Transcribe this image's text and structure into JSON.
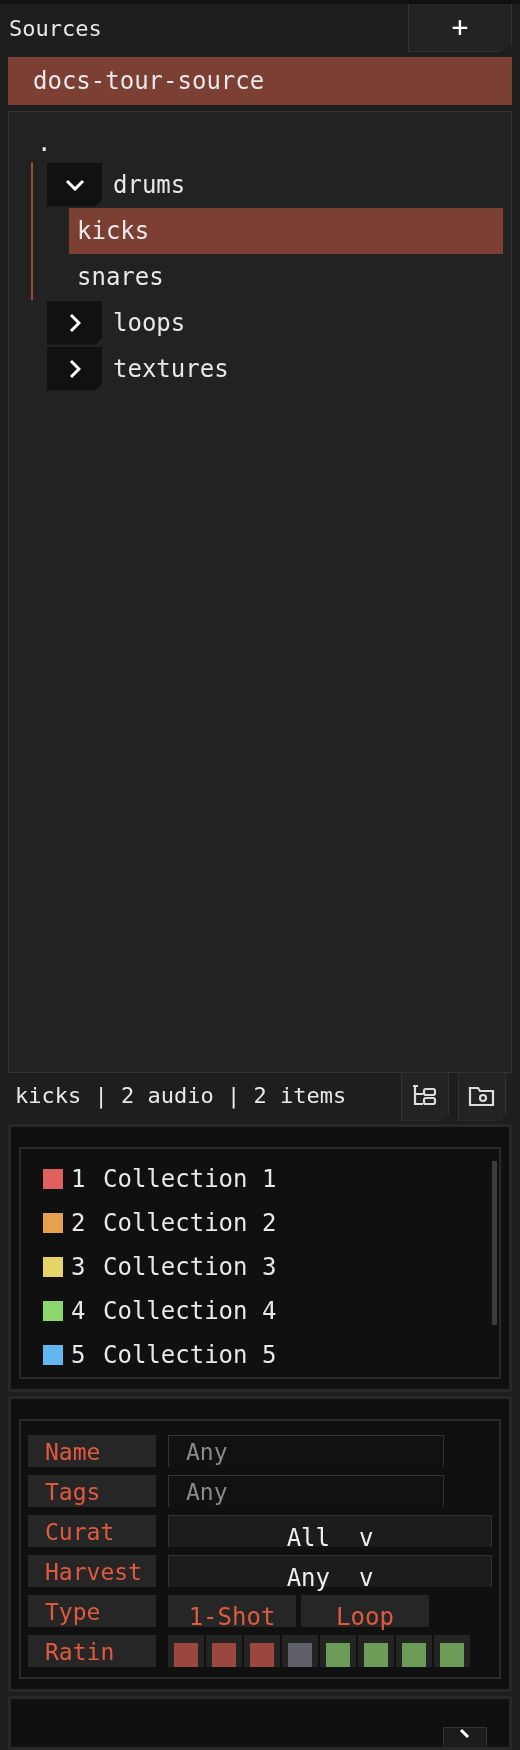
{
  "sources": {
    "title": "Sources",
    "add_button": "+",
    "items": [
      {
        "label": "docs-tour-source",
        "selected": true
      }
    ]
  },
  "tree": {
    "label": ".",
    "children": [
      {
        "label": "drums",
        "expanded": true,
        "selected": false,
        "children": [
          {
            "label": "kicks",
            "selected": true
          },
          {
            "label": "snares",
            "selected": false
          }
        ]
      },
      {
        "label": "loops",
        "expanded": false,
        "selected": false
      },
      {
        "label": "textures",
        "expanded": false,
        "selected": false
      }
    ]
  },
  "status": {
    "text": "kicks | 2 audio | 2 items"
  },
  "collections": [
    {
      "number": "1",
      "name": "Collection 1",
      "color": "#e06060"
    },
    {
      "number": "2",
      "name": "Collection 2",
      "color": "#e6a050"
    },
    {
      "number": "3",
      "name": "Collection 3",
      "color": "#e6d468"
    },
    {
      "number": "4",
      "name": "Collection 4",
      "color": "#8cd86e"
    },
    {
      "number": "5",
      "name": "Collection 5",
      "color": "#62b8ee"
    }
  ],
  "filters": [
    {
      "kind": "text",
      "label": "Name",
      "placeholder": "Any"
    },
    {
      "kind": "text",
      "label": "Tags",
      "placeholder": "Any"
    },
    {
      "kind": "select",
      "label": "Curat",
      "value": "All  v"
    },
    {
      "kind": "select",
      "label": "Harvest",
      "value": "Any  v"
    },
    {
      "kind": "toggles",
      "label": "Type",
      "options": [
        "1-Shot",
        "Loop"
      ]
    },
    {
      "kind": "rating",
      "label": "Ratin",
      "swatches": [
        {
          "color": "#9c4640"
        },
        {
          "color": "#9c4640"
        },
        {
          "color": "#9c4640"
        },
        {
          "color": "#606068"
        },
        {
          "color": "#6c9c58"
        },
        {
          "color": "#6c9c58"
        },
        {
          "color": "#6c9c58"
        },
        {
          "color": "#6c9c58"
        }
      ]
    }
  ]
}
